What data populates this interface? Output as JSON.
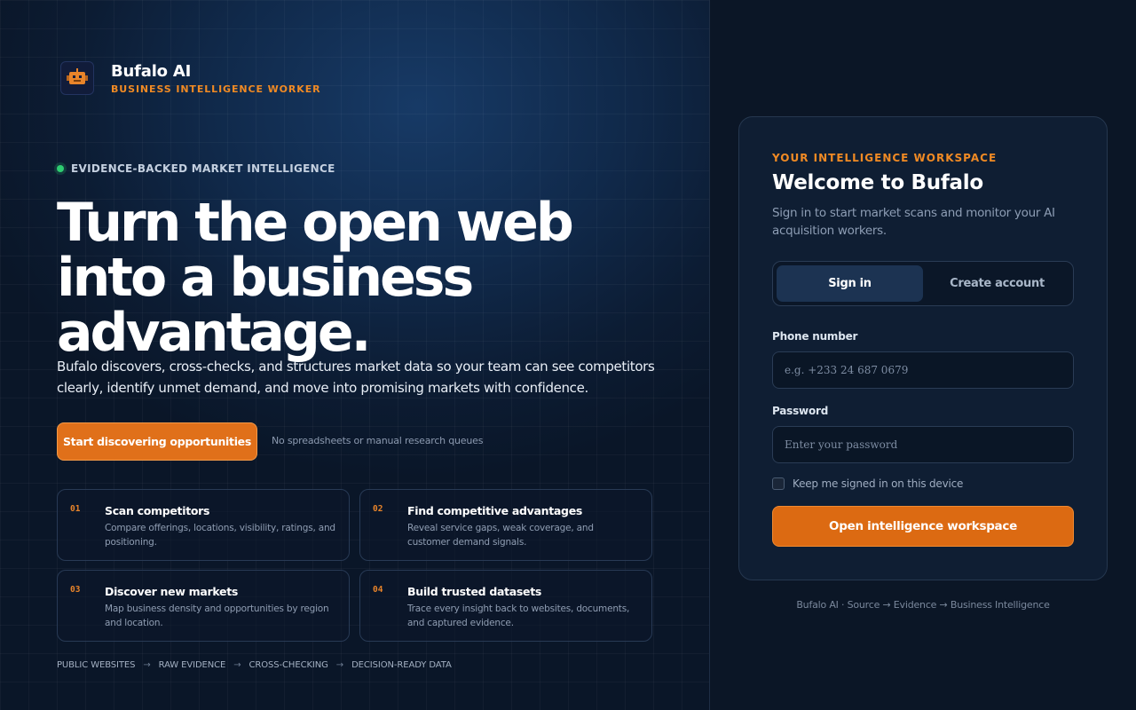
{
  "brand": {
    "name": "Bufalo AI",
    "tagline": "BUSINESS INTELLIGENCE WORKER"
  },
  "hero": {
    "eyebrow": "EVIDENCE-BACKED MARKET INTELLIGENCE",
    "headline_lines": [
      "Turn the open web",
      "into a business",
      "advantage."
    ],
    "lede": "Bufalo discovers, cross-checks, and structures market data so your team can see competitors clearly, identify unmet demand, and move into promising markets with confidence.",
    "cta_label": "Start discovering opportunities",
    "cta_note": "No spreadsheets or manual research queues",
    "features": [
      {
        "num": "01",
        "title": "Scan competitors",
        "desc": "Compare offerings, locations, visibility, ratings, and positioning."
      },
      {
        "num": "02",
        "title": "Find competitive advantages",
        "desc": "Reveal service gaps, weak coverage, and customer demand signals."
      },
      {
        "num": "03",
        "title": "Discover new markets",
        "desc": "Map business density and opportunities by region and location."
      },
      {
        "num": "04",
        "title": "Build trusted datasets",
        "desc": "Trace every insight back to websites, documents, and captured evidence."
      }
    ],
    "pipeline": [
      "PUBLIC WEBSITES",
      "RAW EVIDENCE",
      "CROSS-CHECKING",
      "DECISION-READY DATA"
    ],
    "pipeline_separator": "→"
  },
  "auth": {
    "eyebrow": "YOUR INTELLIGENCE WORKSPACE",
    "title": "Welcome to Bufalo",
    "subtitle": "Sign in to start market scans and monitor your AI acquisition workers.",
    "tabs": {
      "signin": "Sign in",
      "create": "Create account"
    },
    "phone": {
      "label": "Phone number",
      "placeholder": "e.g. +233 24 687 0679",
      "value": ""
    },
    "password": {
      "label": "Password",
      "placeholder": "Enter your password",
      "value": ""
    },
    "remember_label": "Keep me signed in on this device",
    "remember_checked": false,
    "submit_label": "Open intelligence workspace"
  },
  "footer": "Bufalo AI · Source → Evidence → Business Intelligence",
  "colors": {
    "accent": "#e0701a",
    "accent_text": "#f08a24",
    "status_dot": "#2ecc71",
    "panel_bg": "#0f1e33",
    "page_bg": "#0b1626"
  }
}
